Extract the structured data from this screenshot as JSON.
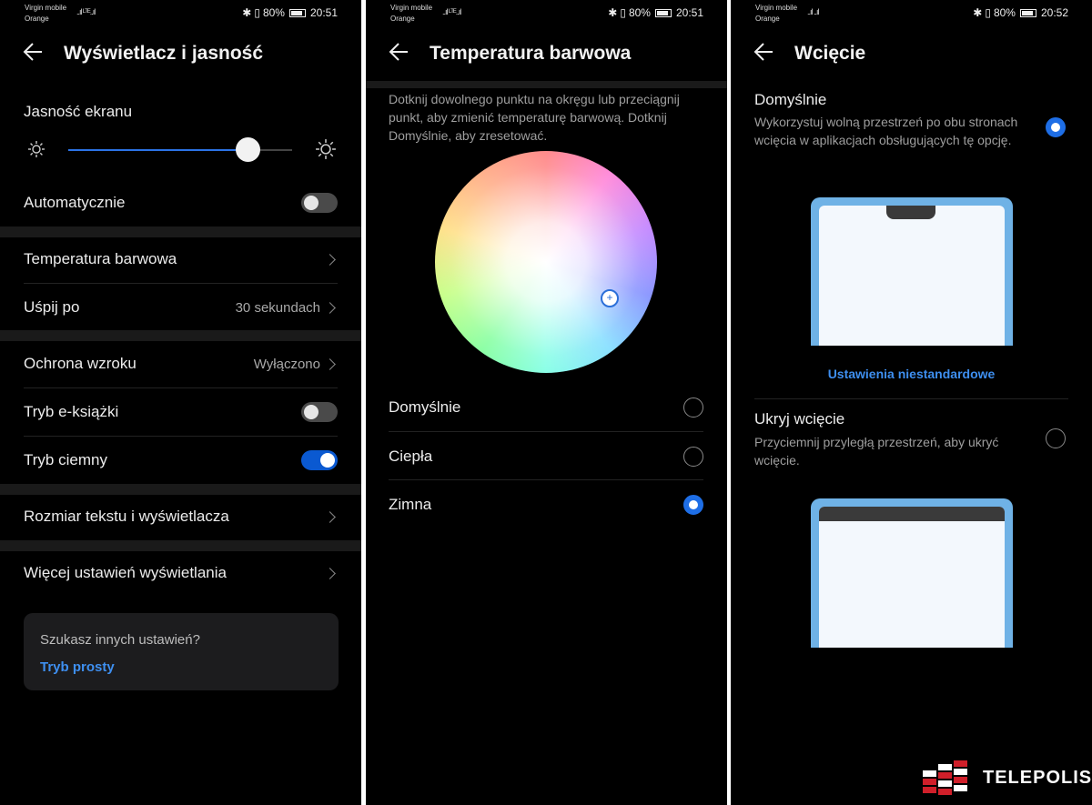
{
  "status_bars": [
    {
      "carrier1": "Virgin mobile",
      "carrier2": "Orange",
      "signal": "..ıl ᴸᵀᴱ..ıl",
      "battery": "80%",
      "time": "20:51"
    },
    {
      "carrier1": "Virgin mobile",
      "carrier2": "Orange",
      "signal": "..ıl ᴸᵀᴱ..ıl",
      "battery": "80%",
      "time": "20:51"
    },
    {
      "carrier1": "Virgin mobile",
      "carrier2": "Orange",
      "signal": "..ıl ..ıl",
      "battery": "80%",
      "time": "20:52"
    }
  ],
  "display": {
    "title": "Wyświetlacz i jasność",
    "brightness_label": "Jasność ekranu",
    "brightness_level": 0.8,
    "auto_label": "Automatycznie",
    "auto_on": false,
    "items": [
      {
        "label": "Temperatura barwowa",
        "value": ""
      },
      {
        "label": "Uśpij po",
        "value": "30 sekundach"
      },
      {
        "label": "Ochrona wzroku",
        "value": "Wyłączono"
      },
      {
        "label": "Tryb e-książki",
        "toggle": false
      },
      {
        "label": "Tryb ciemny",
        "toggle": true
      },
      {
        "label": "Rozmiar tekstu i wyświetlacza",
        "value": ""
      },
      {
        "label": "Więcej ustawień wyświetlania",
        "value": ""
      }
    ],
    "card_question": "Szukasz innych ustawień?",
    "card_link": "Tryb prosty"
  },
  "color_temp": {
    "title": "Temperatura barwowa",
    "description": "Dotknij dowolnego punktu na okręgu lub przeciągnij punkt, aby zmienić temperaturę barwową. Dotknij Domyślnie, aby zresetować.",
    "marker_symbol": "+",
    "options": [
      {
        "label": "Domyślnie",
        "selected": false
      },
      {
        "label": "Ciepła",
        "selected": false
      },
      {
        "label": "Zimna",
        "selected": true
      }
    ]
  },
  "notch": {
    "title": "Wcięcie",
    "default_title": "Domyślnie",
    "default_desc": "Wykorzystuj wolną przestrzeń po obu stronach wcięcia w aplikacjach obsługujących tę opcję.",
    "default_selected": true,
    "custom_link": "Ustawienia niestandardowe",
    "hide_title": "Ukryj wcięcie",
    "hide_desc": "Przyciemnij przyległą przestrzeń, aby ukryć wcięcie.",
    "hide_selected": false
  },
  "watermark": "TELEPOLIS",
  "colors": {
    "accent": "#1e6ee6",
    "link": "#3e8ff0",
    "background": "#000000"
  }
}
